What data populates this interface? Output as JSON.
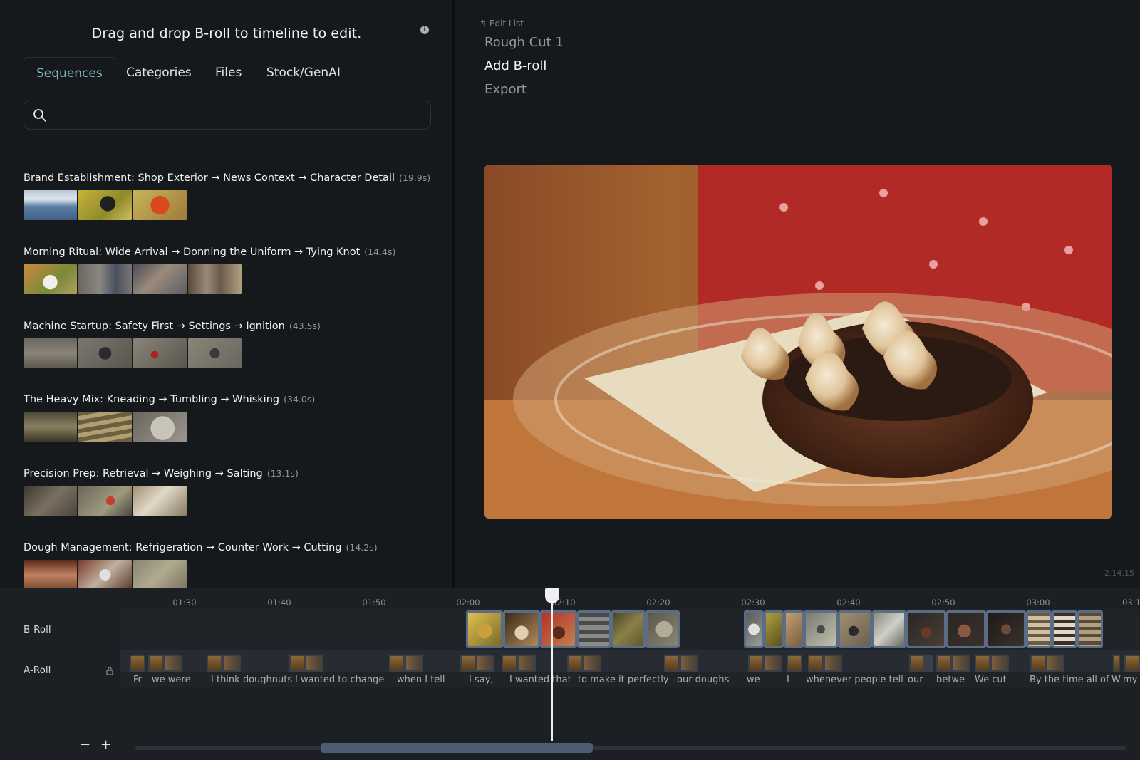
{
  "left": {
    "title": "Drag and drop B-roll to timeline to edit.",
    "tabs": [
      "Sequences",
      "Categories",
      "Files",
      "Stock/GenAI"
    ],
    "search_placeholder": "",
    "sequences": [
      {
        "title": "Brand Establishment: Shop Exterior → News Context → Character Detail",
        "duration": "(19.9s)"
      },
      {
        "title": "Morning Ritual: Wide Arrival → Donning the Uniform → Tying Knot",
        "duration": "(14.4s)"
      },
      {
        "title": "Machine Startup: Safety First → Settings → Ignition",
        "duration": "(43.5s)"
      },
      {
        "title": "The Heavy Mix: Kneading → Tumbling → Whisking",
        "duration": "(34.0s)"
      },
      {
        "title": "Precision Prep: Retrieval → Weighing → Salting",
        "duration": "(13.1s)"
      },
      {
        "title": "Dough Management: Refrigeration → Counter Work → Cutting",
        "duration": "(14.2s)"
      }
    ]
  },
  "right": {
    "edit_list": "Edit List",
    "nav": [
      "Rough Cut 1",
      "Add B-roll",
      "Export"
    ],
    "version": "2.14.15"
  },
  "timeline": {
    "ticks": [
      "01:30",
      "01:40",
      "01:50",
      "02:00",
      "02:10",
      "02:20",
      "02:30",
      "02:40",
      "02:50",
      "03:00",
      "03:1"
    ],
    "broll_label": "B-Roll",
    "aroll_label": "A-Roll",
    "words": [
      "Fr",
      "we were",
      "I think doughnuts",
      "I wanted to change",
      "when I tell",
      "I say,",
      "I wanted that",
      "to make it perfectly",
      "our doughs",
      "we",
      "I",
      "whenever people tell",
      "our",
      "betwe",
      "We cut",
      "By the time all of",
      "W",
      "my r"
    ],
    "zoom_out": "−",
    "zoom_in": "+"
  }
}
